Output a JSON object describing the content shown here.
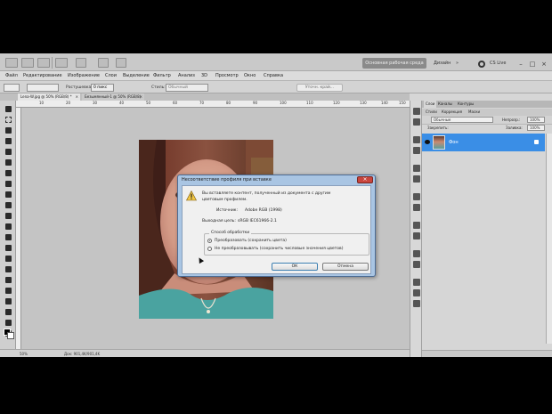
{
  "app": {
    "essentials_label": "Основная рабочая среда",
    "cs_live_label": "CS Live",
    "workspace_label": "Дизайн",
    "window_controls": [
      "–",
      "□",
      "×"
    ]
  },
  "menu": [
    "Файл",
    "Редактирование",
    "Изображение",
    "Слои",
    "Выделение",
    "Фильтр",
    "Анализ",
    "3D",
    "Просмотр",
    "Окно",
    "Справка"
  ],
  "options_bar": {
    "feather_label": "Растушевка:",
    "feather_value": "0 пикс",
    "style_label": "Стиль:",
    "style_value": "Обычный",
    "refine_label": "Уточн. край..."
  },
  "doc_tabs": [
    {
      "label": "Lenа-W.jpg @ 50% (RGB/8) *",
      "close": "×"
    },
    {
      "label": "Безымянный-1 @ 50% (RGB/8)",
      "close": "×"
    }
  ],
  "ruler_numbers": [
    "10",
    "20",
    "30",
    "40",
    "50",
    "60",
    "70",
    "80",
    "90",
    "100",
    "110",
    "120",
    "130",
    "140",
    "150"
  ],
  "status": {
    "zoom": "50%",
    "doc_info": "Док: 901,4K/901,4K"
  },
  "layers_panel": {
    "tabs": [
      "Слои",
      "Каналы",
      "Контуры"
    ],
    "subtabs": [
      "Стили",
      "Коррекция",
      "Маски"
    ],
    "blend_mode": "Обычные",
    "opacity_label": "Непрозр.:",
    "opacity_value": "100%",
    "lock_label": "Закрепить:",
    "fill_label": "Заливка:",
    "fill_value": "100%",
    "layer_name": "Фон"
  },
  "dialog": {
    "title": "Несоответствие профиля при вставке",
    "message_line1": "Вы вставляете контент, полученный из документа с другим",
    "message_line2": "цветовым профилем.",
    "source_label": "Источник:",
    "source_value": "Adobe RGB (1998)",
    "target_label": "Выходная цель:",
    "target_value": "sRGB IEC61966-2.1",
    "group_label": "Способ обработки",
    "option_convert": "Преобразовать (сохранить цвета)",
    "option_keep": "Не преобразовывать (сохранить числовые значения цветов)",
    "ok_label": "ОК",
    "cancel_label": "Отмена",
    "close_glyph": "×"
  }
}
